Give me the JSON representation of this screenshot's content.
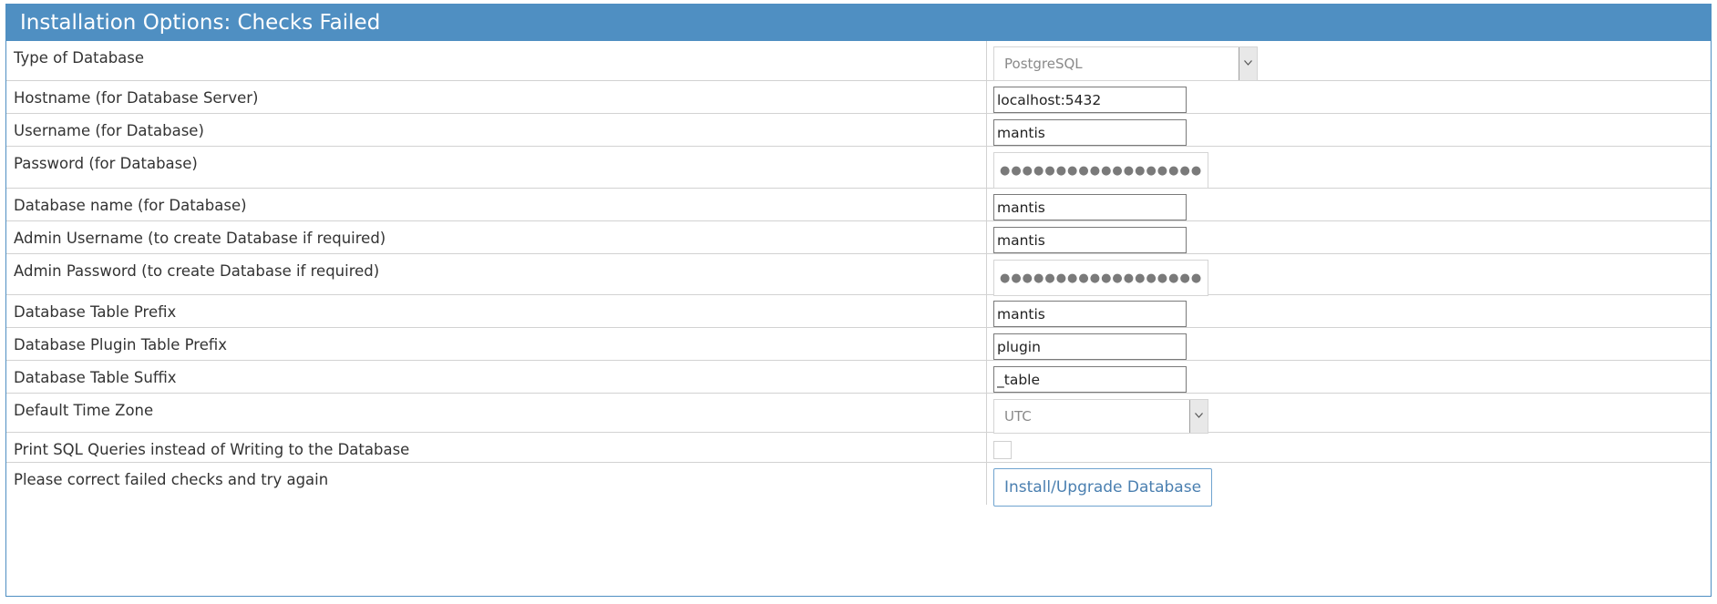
{
  "header": {
    "title": "Installation Options: Checks Failed"
  },
  "form": {
    "db_type": {
      "label": "Type of Database",
      "value": "PostgreSQL"
    },
    "hostname": {
      "label": "Hostname (for Database Server)",
      "value": "localhost:5432"
    },
    "username": {
      "label": "Username (for Database)",
      "value": "mantis"
    },
    "password": {
      "label": "Password (for Database)",
      "value": "●●●●●●●●●●●●●●●●●●●●"
    },
    "db_name": {
      "label": "Database name (for Database)",
      "value": "mantis"
    },
    "admin_username": {
      "label": "Admin Username (to create Database if required)",
      "value": "mantis"
    },
    "admin_password": {
      "label": "Admin Password (to create Database if required)",
      "value": "●●●●●●●●●●●●●●●●●●●●"
    },
    "table_prefix": {
      "label": "Database Table Prefix",
      "value": "mantis"
    },
    "plugin_prefix": {
      "label": "Database Plugin Table Prefix",
      "value": "plugin"
    },
    "table_suffix": {
      "label": "Database Table Suffix",
      "value": "_table"
    },
    "timezone": {
      "label": "Default Time Zone",
      "value": "UTC"
    },
    "print_sql": {
      "label": "Print SQL Queries instead of Writing to the Database",
      "checked": false
    },
    "submit": {
      "label": "Please correct failed checks and try again",
      "button_label": "Install/Upgrade Database"
    }
  },
  "icons": {
    "dropdown": "chevron-down-icon"
  },
  "colors": {
    "header_bg": "#4f8fc2",
    "button_text": "#4a7fb0"
  }
}
